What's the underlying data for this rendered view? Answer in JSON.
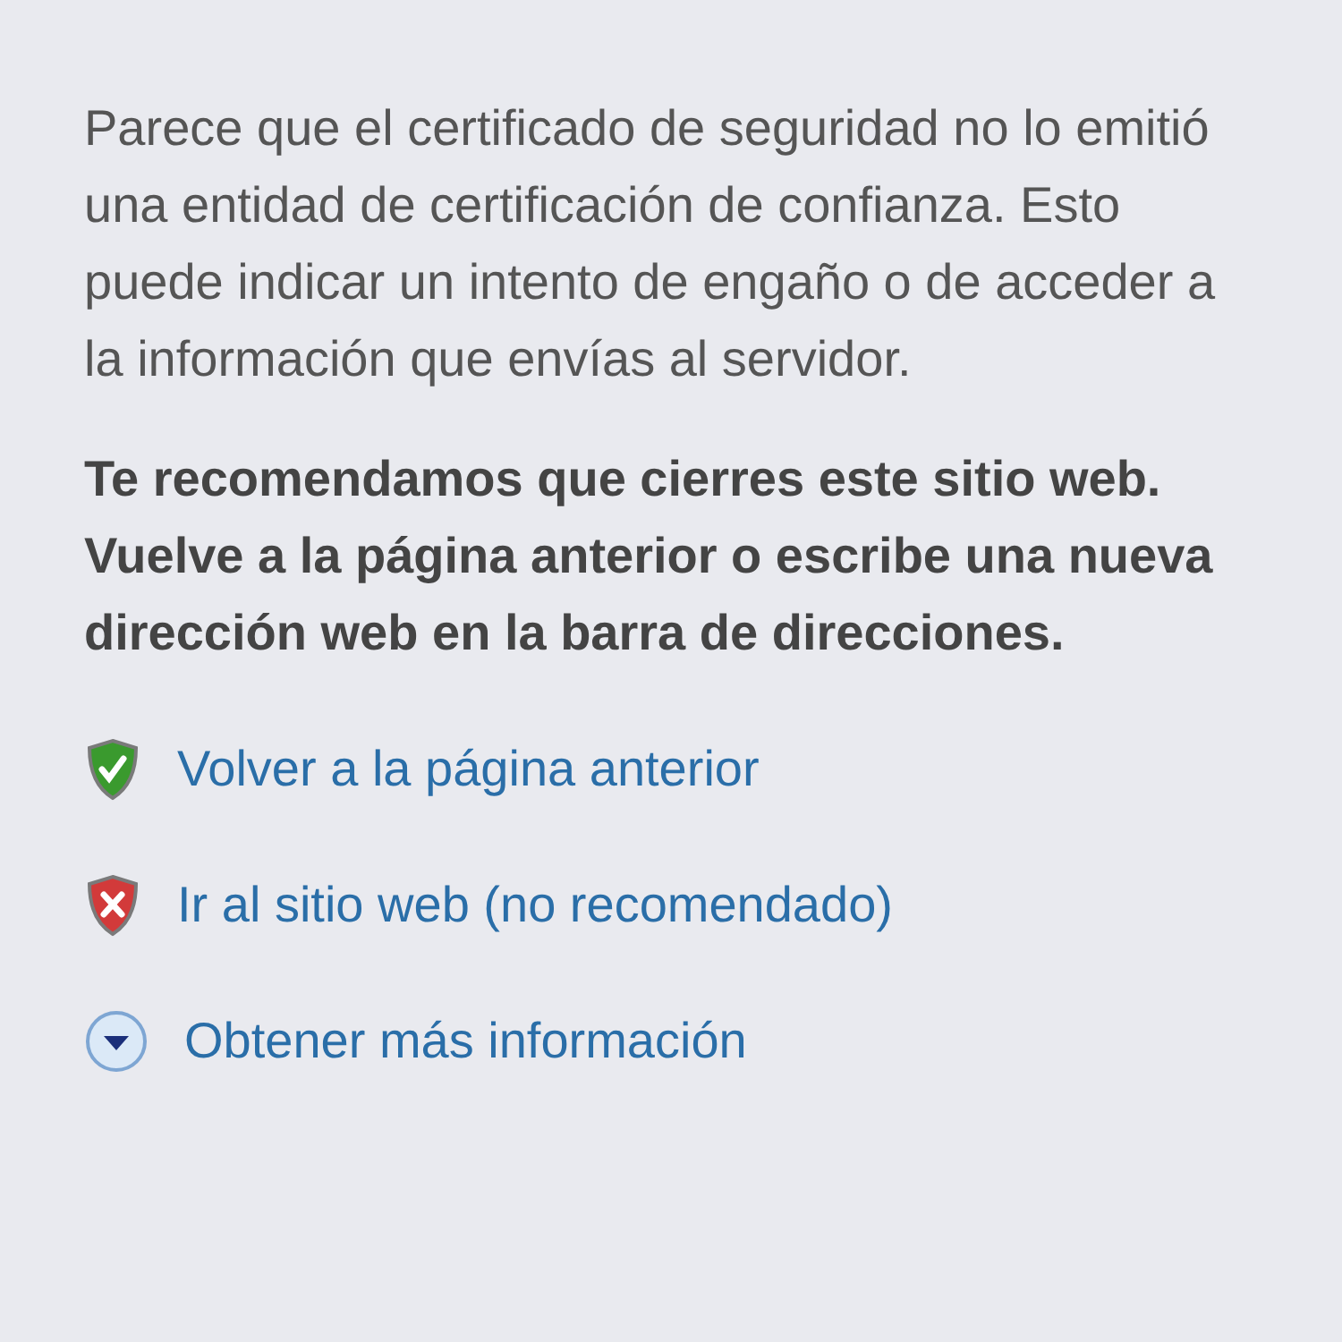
{
  "description": "Parece que el certificado de seguridad no lo emitió una entidad de certificación de confianza. Esto puede indicar un intento de engaño o de acceder a la información que envías al servidor.",
  "recommendation": "Te recomendamos que cierres este sitio web. Vuelve a la página anterior o escribe una nueva dirección web en la barra de direcciones.",
  "links": [
    {
      "kind": "safe",
      "label": "Volver a la página anterior"
    },
    {
      "kind": "unsafe",
      "label": "Ir al sitio web (no recomendado)"
    },
    {
      "kind": "more",
      "label": "Obtener más información"
    }
  ]
}
